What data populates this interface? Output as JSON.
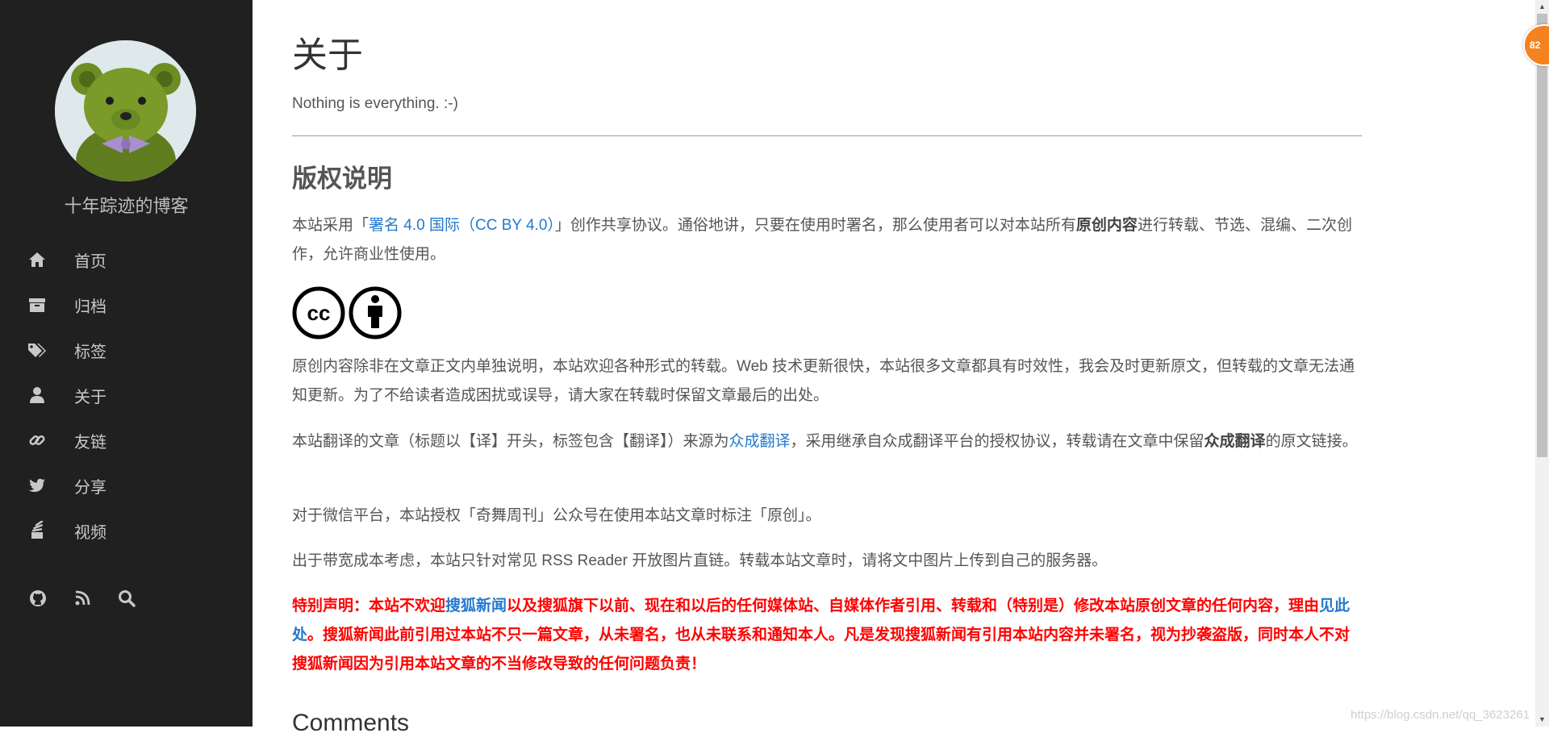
{
  "sidebar": {
    "blog_title": "十年踪迹的博客",
    "nav": [
      {
        "label": "首页",
        "icon": "home-icon"
      },
      {
        "label": "归档",
        "icon": "archive-icon"
      },
      {
        "label": "标签",
        "icon": "tags-icon"
      },
      {
        "label": "关于",
        "icon": "user-icon"
      },
      {
        "label": "友链",
        "icon": "link-icon"
      },
      {
        "label": "分享",
        "icon": "twitter-icon"
      },
      {
        "label": "视频",
        "icon": "stack-icon"
      }
    ],
    "social_icons": [
      "github-icon",
      "rss-icon",
      "search-icon"
    ]
  },
  "main": {
    "title": "关于",
    "subtitle": "Nothing is everything. :-)",
    "section_title": "版权说明",
    "p1": {
      "before": "本站采用「",
      "link": "署名 4.0 国际（CC BY 4.0）",
      "mid": "」创作共享协议。通俗地讲，只要在使用时署名，那么使用者可以对本站所有",
      "bold": "原创内容",
      "after": "进行转载、节选、混编、二次创作，允许商业性使用。"
    },
    "cc_icons": [
      "cc-icon",
      "by-attribution-icon"
    ],
    "cc_text": "cc",
    "p2": "原创内容除非在文章正文内单独说明，本站欢迎各种形式的转载。Web 技术更新很快，本站很多文章都具有时效性，我会及时更新原文，但转载的文章无法通知更新。为了不给读者造成困扰或误导，请大家在转载时保留文章最后的出处。",
    "p3": {
      "before": "本站翻译的文章（标题以【译】开头，标签包含【翻译】）来源为",
      "link": "众成翻译",
      "mid": "，采用继承自众成翻译平台的授权协议，转载请在文章中保留",
      "bold": "众成翻译",
      "after": "的原文链接。"
    },
    "p4": "对于微信平台，本站授权「奇舞周刊」公众号在使用本站文章时标注「原创」。",
    "p5": "出于带宽成本考虑，本站只针对常见 RSS Reader 开放图片直链。转载本站文章时，请将文中图片上传到自己的服务器。",
    "warning": {
      "before": "特别声明：本站不欢迎",
      "link1": "搜狐新闻",
      "mid": "以及搜狐旗下以前、现在和以后的任何媒体站、自媒体作者引用、转载和（特别是）修改本站原创文章的任何内容，理由",
      "link2": "见此处",
      "after": "。搜狐新闻此前引用过本站不只一篇文章，从未署名，也从未联系和通知本人。凡是发现搜狐新闻有引用本站内容并未署名，视为抄袭盗版，同时本人不对搜狐新闻因为引用本站文章的不当修改导致的任何问题负责！"
    },
    "comments_heading": "Comments"
  },
  "overlay": {
    "badge": "82",
    "watermark": "https://blog.csdn.net/qq_3623261"
  },
  "colors": {
    "sidebar_bg": "#202020",
    "link": "#2479cc",
    "warning": "#ff0000",
    "badge": "#f58220"
  }
}
